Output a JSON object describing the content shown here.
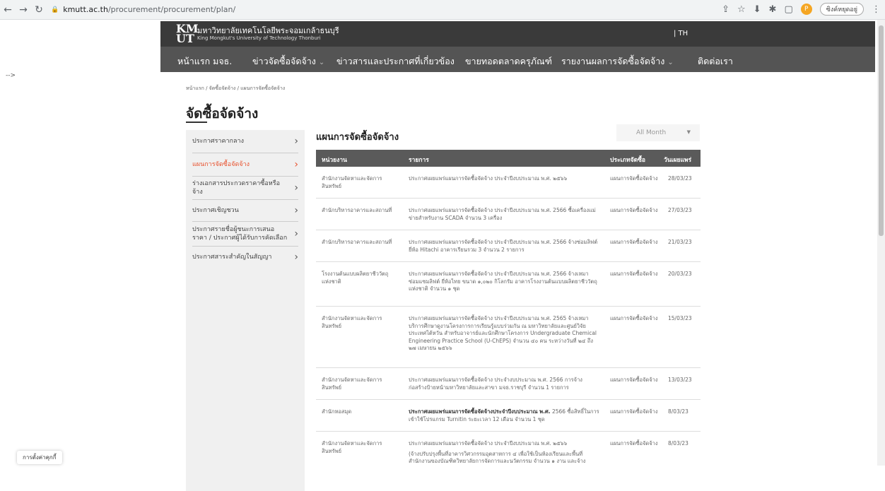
{
  "browser": {
    "url_host": "kmutt.ac.th",
    "url_path": "/procurement/procurement/plan/",
    "pause_label": "ซิงค์หยุดอยู่"
  },
  "header": {
    "logo_mark": "KM UT",
    "logo_th": "มหาวิทยาลัยเทคโนโลยีพระจอมเกล้าธนบุรี",
    "logo_en": "King Mongkut's University of Technology Thonburi",
    "lang": "| TH"
  },
  "nav": {
    "items": [
      "หน้าแรก มจธ.",
      "ข่าวจัดซื้อจัดจ้าง",
      "ข่าวสารและประกาศที่เกี่ยวข้อง",
      "ขายทอดตลาดครุภัณฑ์",
      "รายงานผลการจัดซื้อจัดจ้าง",
      "ติดต่อเรา"
    ]
  },
  "stray_text": "-->",
  "breadcrumb": "หน้าแรก / จัดซื้อจัดจ้าง / แผนการจัดซื้อจัดจ้าง",
  "page_title": "จัดซื้อจัดจ้าง",
  "sidebar": {
    "items": [
      "ประกาศราคากลาง",
      "แผนการจัดซื้อจัดจ้าง",
      "ร่างเอกสารประกวดราคาซื้อหรือจ้าง",
      "ประกาศเชิญชวน",
      "ประกาศรายชื่อผู้ชนะการเสนอราคา / ประกาศผู้ได้รับการคัดเลือก",
      "ประกาศสาระสำคัญในสัญญา"
    ]
  },
  "section_title": "แผนการจัดซื้อจัดจ้าง",
  "month_filter": "All Month",
  "table": {
    "headers": [
      "หน่วยงาน",
      "รายการ",
      "ประเภทจัดซื้อ",
      "วันเผยแพร่"
    ],
    "rows": [
      {
        "unit": "สำนักงานจัดหาและจัดการสินทรัพย์",
        "item": "ประกาศเผยแพร่แผนการจัดซื้อจัดจ้าง ประจำปีงบประมาณ พ.ศ. ๒๕๖๖",
        "type": "แผนการจัดซื้อจัดจ้าง",
        "date": "28/03/23"
      },
      {
        "unit": "สำนักบริหารอาคารและสถานที่",
        "item": "ประกาศเผยแพร่แผนการจัดซื้อจัดจ้าง ประจำปีงบประมาณ พ.ศ. 2566 ซื้อเครื่องแม่ข่ายสำหรับงาน SCADA จำนวน 3 เครื่อง",
        "type": "แผนการจัดซื้อจัดจ้าง",
        "date": "27/03/23"
      },
      {
        "unit": "สำนักบริหารอาคารและสถานที่",
        "item": "ประกาศเผยแพร่แผนการจัดซื้อจัดจ้าง ประจำปีงบประมาณ พ.ศ. 2566 จ้างซ่อมลิฟต์ยี่ห้อ Hitachi อาคารเรียนรวม 3 จำนวน 2 รายการ",
        "type": "แผนการจัดซื้อจัดจ้าง",
        "date": "21/03/23"
      },
      {
        "unit": "โรงงานต้นแบบผลิตยาชีววัตถุแห่งชาติ",
        "item": "ประกาศเผยแพร่แผนการจัดซื้อจัดจ้าง ประจำปีงบประมาณ พ.ศ. 2566 จ้างเหมาซ่อมแซมลิฟต์ ยี่ห้อไทย ขนาด ๑,๐๒๐ กิโลกรัม อาคารโรงงานต้นแบบผลิตยาชีววัตถุแห่งชาติ จำนวน ๑ ชุด",
        "type": "แผนการจัดซื้อจัดจ้าง",
        "date": "20/03/23"
      },
      {
        "unit": "สำนักงานจัดหาและจัดการสินทรัพย์",
        "item": "ประกาศเผยแพร่แผนการจัดซื้อจัดจ้าง ประจำปีงบประมาณ พ.ศ. 2565 จ้างเหมาบริการศึกษาดูงานโครงการการเรียนรู้แบบร่วมกัน ณ มหาวิทยาลัยและศูนย์วิจัยประเทศไต้หวัน สำหรับอาจารย์และนักศึกษาโครงการ Undergraduate Chemical Engineering Practice School (U-ChEPS) จำนวน ๔๐ คน ระหว่างวันที่ ๒๔ ถึง ๒๗ เมษายน ๒๕๖๖",
        "type": "แผนการจัดซื้อจัดจ้าง",
        "date": "15/03/23"
      },
      {
        "unit": "สำนักงานจัดหาและจัดการสินทรัพย์",
        "item": "ประกาศเผยแพร่แผนการจัดซื้อจัดจ้าง ประจำงบประมาณ พ.ศ. 2566 การจ้างก่อสร้างป้ายหน้ามหาวิทยาลัยและสาขา มจธ.ราชบุรี จำนวน 1 รายการ",
        "type": "แผนการจัดซื้อจัดจ้าง",
        "date": "13/03/23"
      },
      {
        "unit": "สำนักหอสมุด",
        "item_bold": "ประกาศเผยแพร่แผนการจัดซื้อจัดจ้างประจำปีงบประมาณ พ.ศ.",
        "item": " 2566 ซื้อสิทธิ์ในการเข้าใช้โปรแกรม Turnitin ระยะเวลา 12 เดือน จำนวน 1 ชุด",
        "type": "แผนการจัดซื้อจัดจ้าง",
        "date": "8/03/23"
      },
      {
        "unit": "สำนักงานจัดหาและจัดการสินทรัพย์",
        "item": "ประกาศเผยแพร่แผนการจัดซื้อจัดจ้าง ประจำปีงบประมาณ พ.ศ. ๒๕๖๖",
        "item_2": "(จ้างปรับปรุงพื้นที่อาคารวิศวกรรมอุตสาหการ ๔ เพื่อใช้เป็นห้องเรียนและพื้นที่สำนักงานของบัณฑิตวิทยาลัยการจัดการและนวัตกรรม จำนวน ๑ งาน และจ้าง",
        "type": "แผนการจัดซื้อจัดจ้าง",
        "date": "8/03/23"
      }
    ]
  },
  "cookie_label": "การตั้งค่าคุกกี้"
}
